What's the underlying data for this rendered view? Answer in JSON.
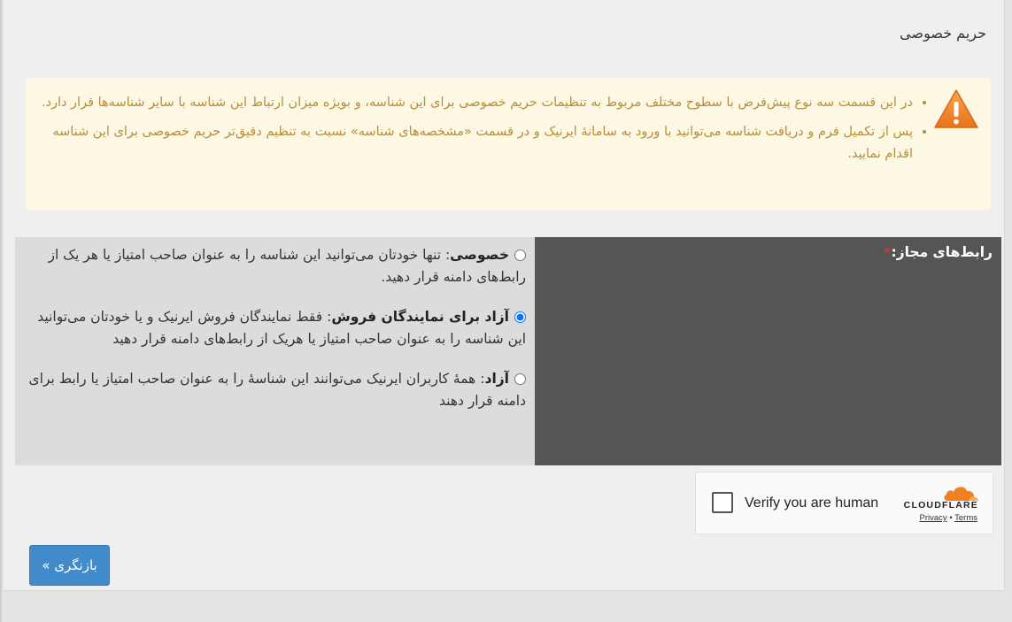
{
  "section": {
    "title": "حریم خصوصی"
  },
  "alert": {
    "icon": "warning-triangle-icon",
    "color": "#b78f3c",
    "background": "#fcf8e3",
    "items": [
      "در این قسمت سه نوع پیش‌فرض با سطوح مختلف مربوط به تنظیمات حریم خصوصی برای این شناسه، و بویژه میزان ارتباط این شناسه با سایر شناسه‌ها قرار دارد.",
      "پس از تکمیل فرم و دریافت شناسه می‌توانید با ورود به سامانۀ ایرنیک و در قسمت «مشخصه‌های شناسه» نسبت به تنظیم دقیق‌تر حریم خصوصی برای این شناسه اقدام نمایید."
    ]
  },
  "permissions": {
    "label": "رابط‌های مجاز:",
    "required_mark": "*",
    "options": [
      {
        "title": "خصوصی",
        "sep": ": ",
        "text": "تنها خودتان می‌توانید این شناسه را به عنوان صاحب امتیاز یا هر یک از رابط‌های دامنه قرار دهید.",
        "checked": false
      },
      {
        "title": "آزاد برای نمایندگان فروش",
        "sep": ": ",
        "text": "فقط نمایندگان فروش ایرنیک و یا خودتان می‌توانید این شناسه را به عنوان صاحب امتیاز یا هریک از رابط‌های دامنه قرار دهید",
        "checked": true
      },
      {
        "title": "آزاد",
        "sep": ": ",
        "text": "همۀ کاربران ایرنیک می‌توانند این شناسۀ را به عنوان صاحب امتیاز یا رابط برای دامنه قرار دهند",
        "checked": false
      }
    ]
  },
  "captcha": {
    "label": "Verify you are human",
    "brand": "CLOUDFLARE",
    "privacy": "Privacy",
    "dot": "•",
    "terms": "Terms",
    "logo_icon": "cloudflare-cloud-icon",
    "logo_color": "#f38020"
  },
  "actions": {
    "back_label": "بازنگری »",
    "button_color": "#428bca"
  }
}
